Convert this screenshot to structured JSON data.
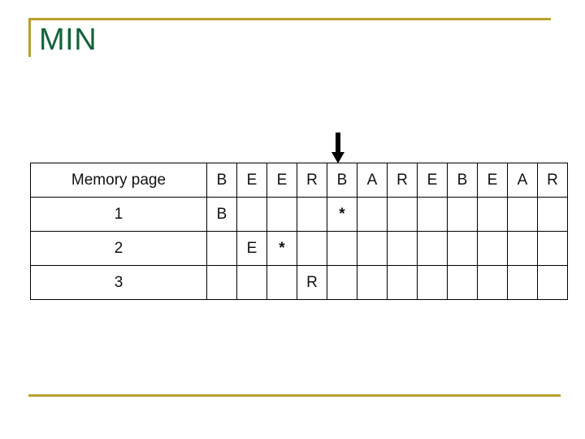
{
  "slide": {
    "title": "MIN",
    "accent_color": "#b8a12e",
    "title_color": "#14623a",
    "letter_color": "#cb8add",
    "star_color": "#a41313"
  },
  "pointer": {
    "icon": "down-arrow-icon",
    "points_to_column_index": 4,
    "points_to_reference": "B"
  },
  "table": {
    "header": {
      "label": "Memory page",
      "reference_string": [
        "B",
        "E",
        "E",
        "R",
        "B",
        "A",
        "R",
        "E",
        "B",
        "E",
        "A",
        "R"
      ]
    },
    "rows": [
      {
        "label": "1",
        "cells": [
          "B",
          "",
          "",
          "",
          "*",
          "",
          "",
          "",
          "",
          "",
          "",
          ""
        ]
      },
      {
        "label": "2",
        "cells": [
          "",
          "E",
          "*",
          "",
          "",
          "",
          "",
          "",
          "",
          "",
          "",
          ""
        ]
      },
      {
        "label": "3",
        "cells": [
          "",
          "",
          "",
          "R",
          "",
          "",
          "",
          "",
          "",
          "",
          "",
          ""
        ]
      }
    ]
  }
}
